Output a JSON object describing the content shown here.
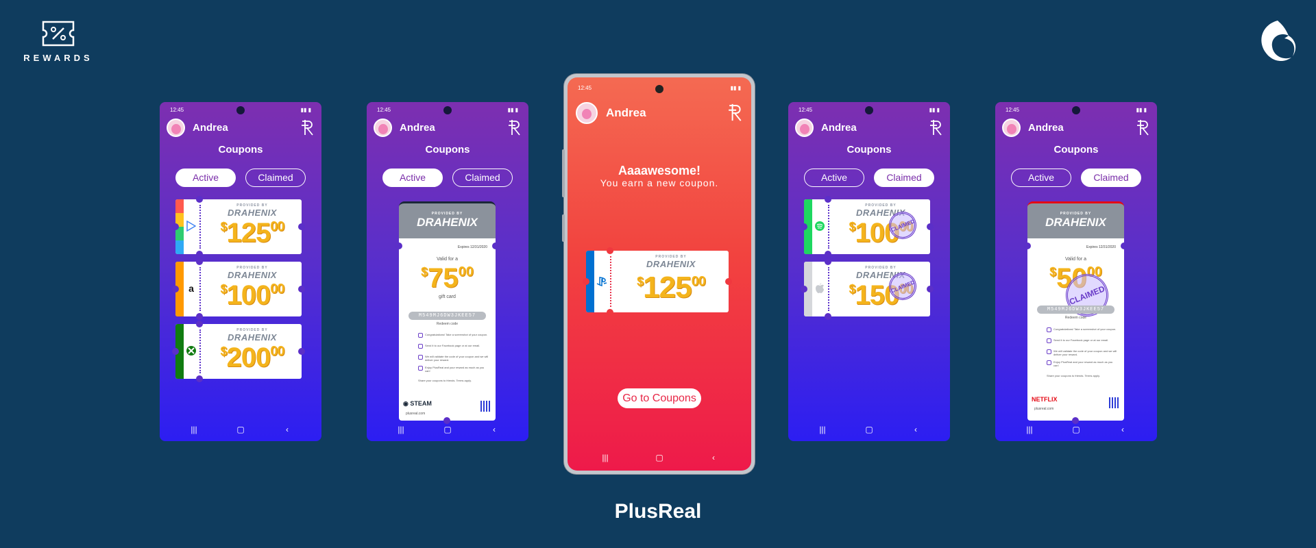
{
  "brand": {
    "label": "REWARDS",
    "icon": "percent-ticket-icon"
  },
  "corner_logo": {
    "icon": "dragon-logo-icon"
  },
  "footer": {
    "title": "PlusReal"
  },
  "colors": {
    "background": "#0f3c5e",
    "accent_gold": "#f4b41c",
    "purple": "#7a2ea9",
    "red": "#ee1a4a"
  },
  "common": {
    "time": "12:45",
    "user": "Andrea",
    "title": "Coupons",
    "tab_active": "Active",
    "tab_claimed": "Claimed",
    "provided_by": "PROVIDED BY",
    "provider": "DRAHENIX",
    "nav_recents": "|||",
    "nav_home": "▢",
    "nav_back": "‹"
  },
  "screen1": {
    "selected_tab": "Active",
    "coupons": [
      {
        "brand": "Google Play",
        "icon": "play-store-icon",
        "dollar": "$",
        "amount": "125",
        "cents": "00"
      },
      {
        "brand": "Amazon",
        "icon": "amazon-icon",
        "dollar": "$",
        "amount": "100",
        "cents": "00"
      },
      {
        "brand": "Xbox",
        "icon": "xbox-icon",
        "dollar": "$",
        "amount": "200",
        "cents": "00"
      }
    ]
  },
  "screen2": {
    "selected_tab": "Active",
    "ticket": {
      "expires": "Expires 12/31/2020",
      "valid_for": "Valid for a",
      "dollar": "$",
      "amount": "75",
      "cents": "00",
      "type": "gift card",
      "code": "M549MJ6DW3JKEE57",
      "code_label": "Redeem code",
      "steps": [
        "Congratulations! Take a screenshot of your coupon.",
        "Send it to our Facebook page or at our email.",
        "We will validate the code of your coupon and we will deliver your reward.",
        "Enjoy PlusReal and your reward as much as you can!"
      ],
      "note": "Share your coupons to friends. Terms apply.",
      "brand": "STEAM",
      "brand_icon": "steam-icon",
      "url": "plusreal.com"
    }
  },
  "screen3": {
    "headline": "Aaaawesome!",
    "subline": "You earn a new coupon.",
    "coupon": {
      "brand": "PlayStation",
      "icon": "playstation-icon",
      "dollar": "$",
      "amount": "125",
      "cents": "00"
    },
    "button": "Go to Coupons"
  },
  "screen4": {
    "selected_tab": "Claimed",
    "stamp": "CLAIMED",
    "coupons": [
      {
        "brand": "Spotify",
        "icon": "spotify-icon",
        "dollar": "$",
        "amount": "100",
        "cents": "00"
      },
      {
        "brand": "Apple",
        "icon": "apple-icon",
        "dollar": "$",
        "amount": "150",
        "cents": "00"
      }
    ]
  },
  "screen5": {
    "selected_tab": "Claimed",
    "stamp": "CLAIMED",
    "ticket": {
      "expires": "Expires 12/31/2020",
      "valid_for": "Valid for a",
      "dollar": "$",
      "amount": "50",
      "cents": "00",
      "code": "M549MJ6DW3JKEE57",
      "code_label": "Redeem code",
      "steps": [
        "Congratulations! Take a screenshot of your coupon.",
        "Send it to our Facebook page or at our email.",
        "We will validate the code of your coupon and we will deliver your reward.",
        "Enjoy PlusReal and your reward as much as you can!"
      ],
      "note": "Share your coupons to friends. Terms apply.",
      "brand": "NETFLIX",
      "url": "plusreal.com"
    }
  }
}
